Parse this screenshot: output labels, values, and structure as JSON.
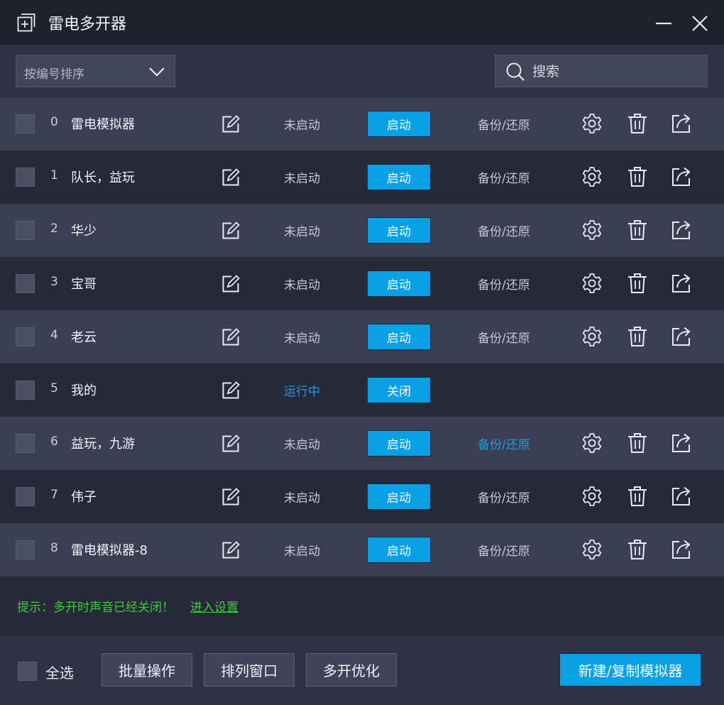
{
  "window": {
    "title": "雷电多开器",
    "app_icon": "add-window-icon",
    "minimize_icon": "minimize-icon",
    "close_icon": "close-icon"
  },
  "toolbar": {
    "sort_label": "按编号排序",
    "sort_icon": "chevron-down-icon",
    "search_placeholder": "搜索",
    "search_icon": "search-icon"
  },
  "rows": [
    {
      "index": "0",
      "name": "雷电模拟器",
      "status": "未启动",
      "action": "启动",
      "backup": "备份/还原",
      "running": false,
      "backup_highlight": false
    },
    {
      "index": "1",
      "name": "队长，益玩",
      "status": "未启动",
      "action": "启动",
      "backup": "备份/还原",
      "running": false,
      "backup_highlight": false
    },
    {
      "index": "2",
      "name": "华少",
      "status": "未启动",
      "action": "启动",
      "backup": "备份/还原",
      "running": false,
      "backup_highlight": false
    },
    {
      "index": "3",
      "name": "宝哥",
      "status": "未启动",
      "action": "启动",
      "backup": "备份/还原",
      "running": false,
      "backup_highlight": false
    },
    {
      "index": "4",
      "name": "老云",
      "status": "未启动",
      "action": "启动",
      "backup": "备份/还原",
      "running": false,
      "backup_highlight": false
    },
    {
      "index": "5",
      "name": "我的",
      "status": "运行中",
      "action": "关闭",
      "backup": "",
      "running": true,
      "backup_highlight": false
    },
    {
      "index": "6",
      "name": "益玩，九游",
      "status": "未启动",
      "action": "启动",
      "backup": "备份/还原",
      "running": false,
      "backup_highlight": true
    },
    {
      "index": "7",
      "name": "伟子",
      "status": "未启动",
      "action": "启动",
      "backup": "备份/还原",
      "running": false,
      "backup_highlight": false
    },
    {
      "index": "8",
      "name": "雷电模拟器-8",
      "status": "未启动",
      "action": "启动",
      "backup": "备份/还原",
      "running": false,
      "backup_highlight": false
    }
  ],
  "row_icons": {
    "edit": "edit-icon",
    "settings": "gear-icon",
    "delete": "trash-icon",
    "shortcut": "share-icon"
  },
  "hint": {
    "text": "提示：多开时声音已经关闭！",
    "link": "进入设置"
  },
  "footer": {
    "select_all": "全选",
    "batch": "批量操作",
    "arrange": "排列窗口",
    "optimize": "多开优化",
    "new_copy": "新建/复制模拟器"
  },
  "colors": {
    "accent": "#0aa0e6",
    "running_text": "#1d9be3",
    "hint_green": "#3ec93e",
    "row_light": "#3a3f54",
    "row_dark": "#262a38"
  }
}
